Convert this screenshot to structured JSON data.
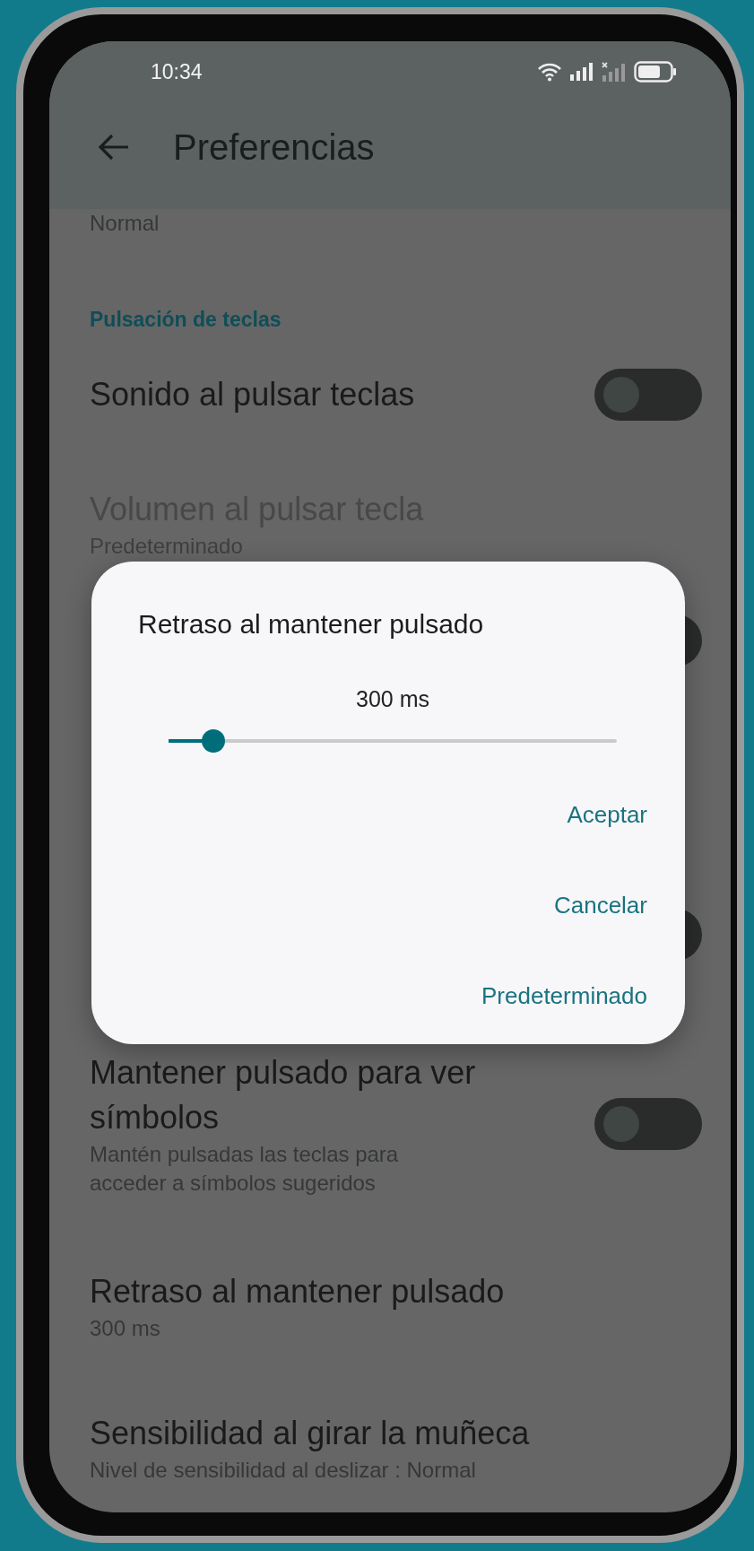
{
  "status_bar": {
    "time": "10:34"
  },
  "app_bar": {
    "title": "Preferencias"
  },
  "preferences": [
    {
      "kind": "summary",
      "summary": "Normal"
    },
    {
      "kind": "category",
      "title": "Pulsación de teclas"
    },
    {
      "kind": "switch",
      "title": "Sonido al pulsar teclas",
      "on": false
    },
    {
      "kind": "text",
      "title": "Volumen al pulsar tecla",
      "summary": "Predeterminado",
      "disabled": true
    },
    {
      "kind": "switch",
      "on": false
    },
    {
      "kind": "switch",
      "on": false
    },
    {
      "kind": "switch",
      "title": "Mantener pulsado para ver símbolos",
      "summary": "Mantén pulsadas las teclas para acceder a símbolos sugeridos",
      "on": false
    },
    {
      "kind": "text",
      "title": "Retraso al mantener pulsado",
      "summary": "300 ms",
      "disabled": false
    },
    {
      "kind": "text",
      "title": "Sensibilidad al girar la muñeca",
      "summary": "Nivel de sensibilidad al deslizar : Normal",
      "disabled": false
    }
  ],
  "dialog": {
    "title": "Retraso al mantener pulsado",
    "value": "300 ms",
    "slider": {
      "level": 0.1
    },
    "buttons": [
      "Aceptar",
      "Cancelar",
      "Predeterminado"
    ]
  }
}
